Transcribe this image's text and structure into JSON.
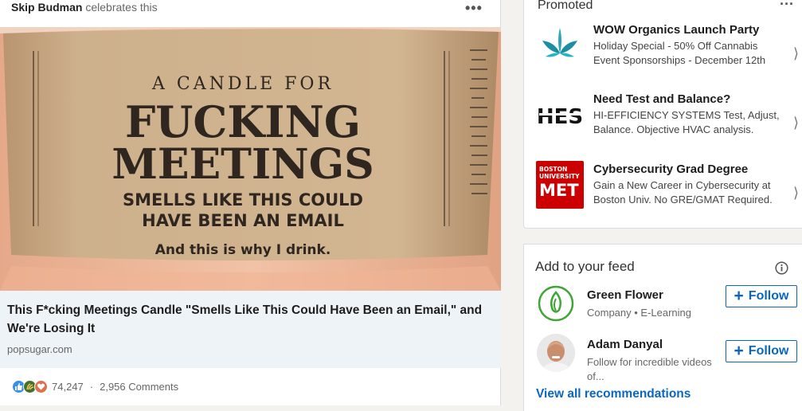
{
  "post": {
    "actor": "Skip Budman",
    "verb": "celebrates this",
    "menu_icon": "overflow-dots-icon",
    "image": {
      "line1": "A CANDLE FOR",
      "line2": "FUCKING",
      "line3": "MEETINGS",
      "line4": "SMELLS LIKE THIS COULD",
      "line5": "HAVE BEEN AN EMAIL",
      "line6": "And this is why I drink."
    },
    "article": {
      "title": "This F*cking Meetings Candle \"Smells Like This Could Have Been an Email,\" and We're Losing It",
      "source": "popsugar.com"
    },
    "social": {
      "reactions_count": "74,247",
      "separator": "·",
      "comments": "2,956 Comments",
      "reaction_icons": [
        "like-icon",
        "celebrate-icon",
        "love-icon"
      ]
    }
  },
  "promoted": {
    "title": "Promoted",
    "ads": [
      {
        "title": "WOW Organics Launch Party",
        "desc": "Holiday Special - 50% Off Cannabis Event Sponsorships - December 12th",
        "logo": "leaf-logo"
      },
      {
        "title": "Need Test and Balance?",
        "desc": "HI-EFFICIENCY SYSTEMS Test, Adjust, Balance. Objective HVAC analysis.",
        "logo": "hes-logo",
        "logo_text": "HES"
      },
      {
        "title": "Cybersecurity Grad Degree",
        "desc": "Gain a New Career in Cybersecurity at Boston Univ. No GRE/GMAT Required.",
        "logo": "bu-met-logo",
        "logo_line1": "BOSTON",
        "logo_line2": "UNIVERSITY",
        "logo_line3": "MET"
      }
    ]
  },
  "feed": {
    "title": "Add to your feed",
    "recs": [
      {
        "name": "Green Flower",
        "sub": "Company • E-Learning",
        "follow": "Follow"
      },
      {
        "name": "Adam Danyal",
        "sub": "Follow for incredible videos of...",
        "follow": "Follow"
      }
    ],
    "view_all": "View all recommendations"
  },
  "colors": {
    "link_blue": "#0a66c2",
    "article_bg": "#eef3f8",
    "label_tan": "#c9a982",
    "bu_red": "#cc0000"
  }
}
